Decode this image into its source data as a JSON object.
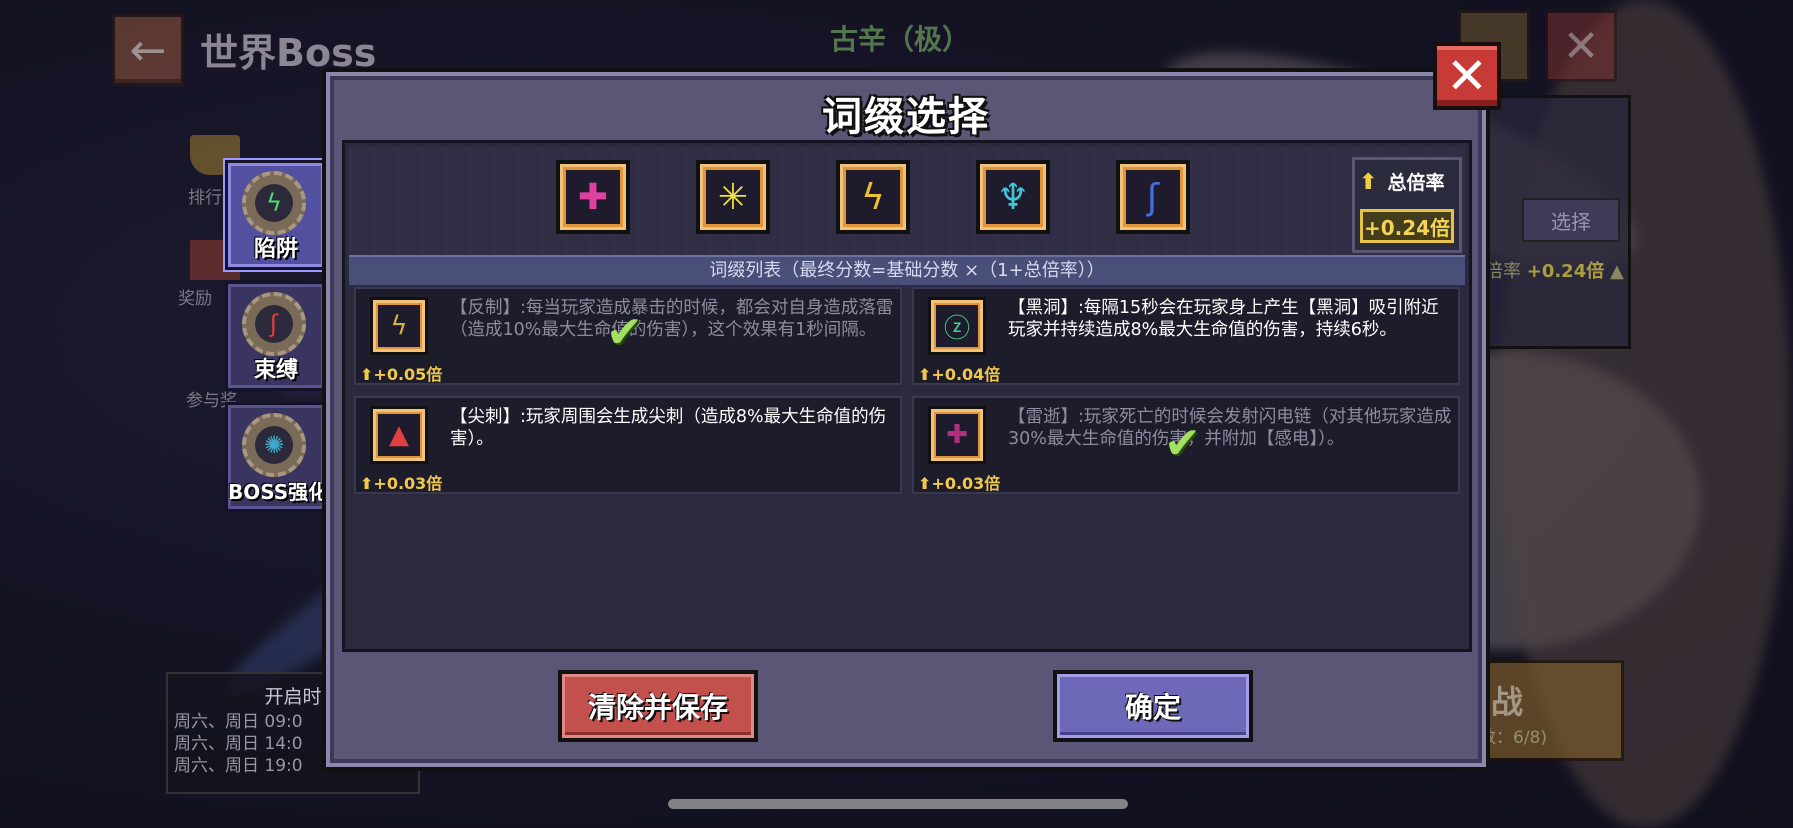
{
  "background": {
    "title": "世界Boss",
    "boss_name": "古辛（极）",
    "side_labels": [
      "排行",
      "奖励",
      "参与奖"
    ],
    "schedule": {
      "header": "开启时",
      "rows": [
        "周六、周日 09:0",
        "周六、周日 14:0",
        "周六、周日 19:0"
      ]
    },
    "right_panel": {
      "select_label": "选择",
      "rate_text_prefix": "倍率",
      "rate_value": "+0.24倍",
      "fight_label": "战",
      "fight_count": "数：6/8)"
    }
  },
  "side_tabs": [
    {
      "label": "陷阱",
      "active": true,
      "icon": "trap-gear-icon"
    },
    {
      "label": "束缚",
      "active": false,
      "icon": "bind-gear-icon"
    },
    {
      "label": "BOSS强化",
      "active": false,
      "icon": "boss-buff-gear-icon"
    }
  ],
  "dialog": {
    "title": "词缀选择",
    "close_glyph": "✕",
    "selected_slots": [
      {
        "icon": "black-hole-affix-icon",
        "glyph": "✚",
        "color": "#e040a0"
      },
      {
        "icon": "burst-affix-icon",
        "glyph": "✳",
        "color": "#f0e040"
      },
      {
        "icon": "lightning-affix-icon",
        "glyph": "ϟ",
        "color": "#f0c030"
      },
      {
        "icon": "wings-affix-icon",
        "glyph": "♆",
        "color": "#40c8d8"
      },
      {
        "icon": "bind-affix-icon",
        "glyph": "ʃ",
        "color": "#4070e0"
      }
    ],
    "total_rate": {
      "label": "总倍率",
      "value": "+0.24倍"
    },
    "list_header": "词缀列表（最终分数=基础分数 ×（1+总倍率））",
    "affixes": [
      {
        "text": "【反制】:每当玩家造成暴击的时候，都会对自身造成落雷（造成10%最大生命值的伤害），这个效果有1秒间隔。",
        "bonus": "+0.05倍",
        "icon": "counter-lightning-icon",
        "glyph": "ϟ",
        "color": "#d8b040",
        "selected": true
      },
      {
        "text": "【黑洞】:每隔15秒会在玩家身上产生【黑洞】吸引附近玩家并持续造成8%最大生命值的伤害，持续6秒。",
        "bonus": "+0.04倍",
        "icon": "black-hole-icon",
        "glyph": "ⓩ",
        "color": "#40d890",
        "selected": false
      },
      {
        "text": "【尖刺】:玩家周围会生成尖刺（造成8%最大生命值的伤害）。",
        "bonus": "+0.03倍",
        "icon": "spike-icon",
        "glyph": "▲",
        "color": "#e04040",
        "selected": false
      },
      {
        "text": "【雷逝】:玩家死亡的时候会发射闪电链（对其他玩家造成30%最大生命值的伤害，并附加【感电】）。",
        "bonus": "+0.03倍",
        "icon": "thunder-death-icon",
        "glyph": "✚",
        "color": "#b03080",
        "selected": true
      }
    ],
    "buttons": {
      "clear_save": "清除并保存",
      "confirm": "确定"
    }
  }
}
